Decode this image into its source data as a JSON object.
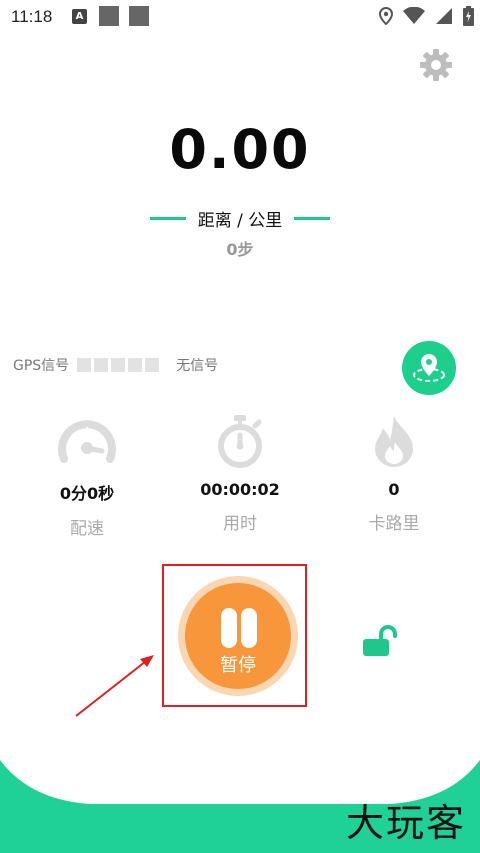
{
  "status_bar": {
    "time": "11:18",
    "notification_badge": "A"
  },
  "header": {
    "settings_icon": "gear-icon"
  },
  "run": {
    "distance": "0.00",
    "distance_unit": "距离 / 公里",
    "steps": "0步"
  },
  "gps": {
    "label": "GPS信号",
    "signal_bars": 5,
    "signal_strength": 0,
    "status": "无信号",
    "location_icon": "map-pin-icon"
  },
  "stats": [
    {
      "icon": "speedometer-icon",
      "value": "0分0秒",
      "label": "配速"
    },
    {
      "icon": "stopwatch-icon",
      "value": "00:00:02",
      "label": "用时"
    },
    {
      "icon": "flame-icon",
      "value": "0",
      "label": "卡路里"
    }
  ],
  "controls": {
    "pause_label": "暂停",
    "lock_icon": "unlock-icon"
  },
  "watermark": "大玩客",
  "colors": {
    "accent": "#1fc78c",
    "pause": "#f7963b",
    "pause_halo": "#fbd6b3",
    "highlight": "#e02020"
  }
}
